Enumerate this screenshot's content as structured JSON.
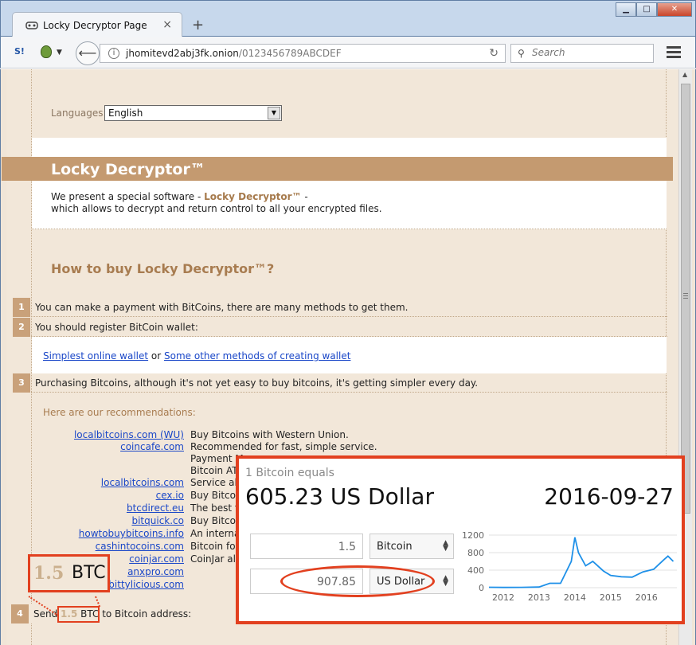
{
  "browser": {
    "tab_title": "Locky Decryptor Page",
    "url_host": "jhomitevd2abj3fk.onion",
    "url_path": "/0123456789ABCDEF",
    "search_placeholder": "Search",
    "nav_s_label": "S!"
  },
  "page": {
    "languages_label": "Languages:",
    "language_selected": "English",
    "header_title": "Locky Decryptor™",
    "intro_line1_pre": "We present a special software - ",
    "intro_line1_bold": "Locky Decryptor™",
    "intro_line1_post": " -",
    "intro_line2": "which allows to decrypt and return control to all your encrypted files.",
    "howto_title": "How to buy Locky Decryptor™?",
    "steps": [
      {
        "num": "1",
        "text": "You can make a payment with BitCoins, there are many methods to get them."
      },
      {
        "num": "2",
        "text": "You should register BitCoin wallet:"
      },
      {
        "num": "3",
        "text": "Purchasing Bitcoins, although it's not yet easy to buy bitcoins, it's getting simpler every day."
      },
      {
        "num": "4",
        "text_pre": "Send ",
        "text_amount": "1.5",
        "text_unit": " BTC",
        "text_post": " to Bitcoin address:"
      }
    ],
    "wallet_link1": "Simplest online wallet",
    "wallet_or": " or ",
    "wallet_link2": "Some other methods of creating wallet",
    "recs_label": "Here are our recommendations:",
    "recommendations": [
      {
        "name": "localbitcoins.com (WU)",
        "desc": "Buy Bitcoins with Western Union."
      },
      {
        "name": "coincafe.com",
        "desc": "Recommended for fast, simple service."
      },
      {
        "name": "",
        "desc": "Payment M"
      },
      {
        "name": "",
        "desc": "Bitcoin ATM"
      },
      {
        "name": "localbitcoins.com",
        "desc": "Service allo"
      },
      {
        "name": "cex.io",
        "desc": "Buy Bitcoin"
      },
      {
        "name": "btcdirect.eu",
        "desc": "The best f"
      },
      {
        "name": "bitquick.co",
        "desc": "Buy Bitcoin"
      },
      {
        "name": "howtobuybitcoins.info",
        "desc": "An internat"
      },
      {
        "name": "cashintocoins.com",
        "desc": "Bitcoin for"
      },
      {
        "name": "coinjar.com",
        "desc": "CoinJar allo"
      },
      {
        "name": "anxpro.com",
        "desc": ""
      },
      {
        "name": "bittylicious.com",
        "desc": ""
      }
    ]
  },
  "btc_zoom": {
    "amount": "1.5",
    "unit": "BTC"
  },
  "rate_panel": {
    "equals_label": "1 Bitcoin equals",
    "rate": "605.23 US Dollar",
    "date": "2016-09-27",
    "btc_value": "1.5",
    "btc_currency": "Bitcoin",
    "usd_value": "907.85",
    "usd_currency": "US Dollar"
  },
  "chart_data": {
    "type": "line",
    "x": [
      2011.5,
      2012.0,
      2012.5,
      2013.0,
      2013.3,
      2013.6,
      2013.9,
      2014.0,
      2014.1,
      2014.3,
      2014.5,
      2014.8,
      2015.0,
      2015.3,
      2015.6,
      2015.9,
      2016.2,
      2016.5,
      2016.6,
      2016.75
    ],
    "values": [
      10,
      5,
      8,
      15,
      100,
      100,
      600,
      1150,
      800,
      500,
      600,
      380,
      280,
      250,
      240,
      360,
      420,
      650,
      720,
      600
    ],
    "xticks": [
      "2012",
      "2013",
      "2014",
      "2015",
      "2016"
    ],
    "xtick_values": [
      2012,
      2013,
      2014,
      2015,
      2016
    ],
    "yticks": [
      "1200",
      "800",
      "400",
      "0"
    ],
    "ytick_values": [
      1200,
      800,
      400,
      0
    ],
    "xlim": [
      2011.6,
      2016.85
    ],
    "ylim": [
      0,
      1200
    ],
    "grid": true,
    "line_color": "#1e90e8"
  }
}
